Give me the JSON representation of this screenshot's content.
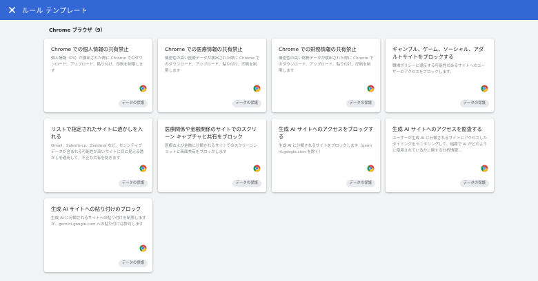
{
  "header": {
    "title": "ルール テンプレート",
    "background_color": "#3367d6",
    "close_icon": "close-icon"
  },
  "section": {
    "heading": "Chrome ブラウザ（9）"
  },
  "cards": [
    {
      "title": "Chrome での個人情報の共有禁止",
      "description": "個人情報（PII）が検出された際に Chrome でのダウンロード、アップロード、貼り付け、印刷を制限します",
      "badge": "データの保護",
      "icon": "chrome-icon"
    },
    {
      "title": "Chrome での医療情報の共有禁止",
      "description": "機密性の高い医療データが検出された際に Chrome でのダウンロード、アップロード、貼り付け、印刷を制限します",
      "badge": "データの保護",
      "icon": "chrome-icon"
    },
    {
      "title": "Chrome での財務情報の共有禁止",
      "description": "機密性の高い財務データが検出された際に Chrome でのダウンロード、アップロード、貼り付け、印刷を制限します",
      "badge": "データの保護",
      "icon": "chrome-icon"
    },
    {
      "title": "ギャンブル、ゲーム、ソーシャル、アダルトサイトをブロックする",
      "description": "職場ポリシーに違反する可能性のあるサイトへのユーザーのアクセスをブロックします。",
      "badge": "データの保護",
      "icon": "chrome-icon"
    },
    {
      "title": "リストで指定されたサイトに透かしを入れる",
      "description": "Gmail、Salesforce、Zendesk など、センシティブ データが含まれる可能性が高いサイトに目に見える透かしを適用して、不正な共有を防ぎます",
      "badge": "データの保護",
      "icon": "chrome-icon"
    },
    {
      "title": "医療関係や金融関係のサイトでのスクリーン キャプチャと共有をブロック",
      "description": "医療および金融に分類されるサイトでのスクリーンショットと画面共有をブロックします",
      "badge": "データの保護",
      "icon": "chrome-icon"
    },
    {
      "title": "生成 AI サイトへのアクセスをブロックする",
      "description": "生成 AI に分類されるサイトをブロックします（gemini.google.com を除く）",
      "badge": "データの保護",
      "icon": "chrome-icon"
    },
    {
      "title": "生成 AI サイトへのアクセスを監査する",
      "description": "ユーザーが生成 AI に分類されるサイトにアクセスしたタイミングをモニタリングして、組織で AI がどのように使用されているかに関する分析情報...",
      "badge": "データの保護",
      "icon": "chrome-icon"
    },
    {
      "title": "生成 AI サイトへの貼り付けのブロック",
      "description": "生成 AI に分類されるサイトへの貼り付けを制限しますが、gemini.google.com への貼り付けは許可します",
      "badge": "データの保護",
      "icon": "chrome-icon"
    }
  ]
}
